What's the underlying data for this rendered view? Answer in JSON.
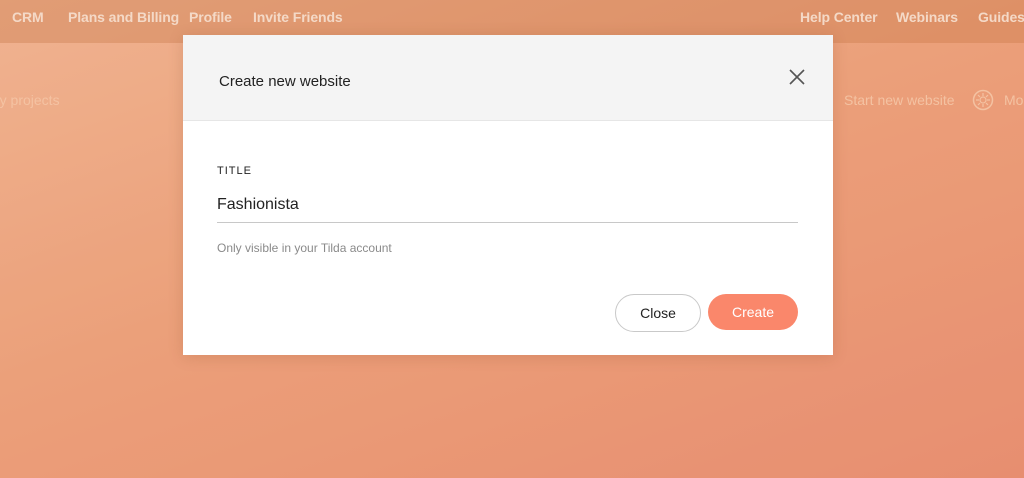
{
  "nav": {
    "left": [
      "CRM",
      "Plans and Billing",
      "Profile",
      "Invite Friends"
    ],
    "right": [
      "Help Center",
      "Webinars",
      "Guides"
    ]
  },
  "background": {
    "breadcrumb": "My projects",
    "start_new_website": "Start new website",
    "more_label": "Mo"
  },
  "modal": {
    "title": "Create new website",
    "field_label": "TITLE",
    "title_value": "Fashionista",
    "hint": "Only visible in your Tilda account",
    "close_label": "Close",
    "create_label": "Create"
  },
  "colors": {
    "accent": "#fa876b",
    "background_top": "#f2b896",
    "background_bottom": "#e88f72"
  }
}
